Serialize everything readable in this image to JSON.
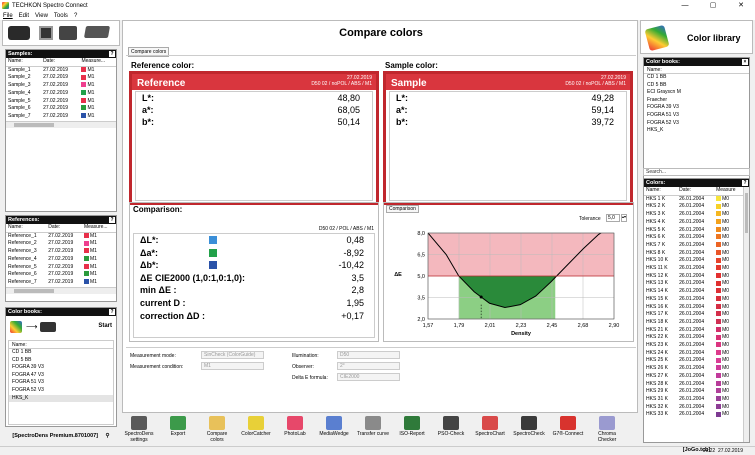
{
  "window": {
    "title": "TECHKON Spectro Connect",
    "min": "—",
    "max": "▢",
    "close": "✕"
  },
  "menu": [
    "File",
    "Edit",
    "View",
    "Tools",
    "?"
  ],
  "samples": {
    "header": "Samples:",
    "cols": [
      "Name:",
      "Date:",
      "Measure..."
    ],
    "rows": [
      {
        "name": "Sample_1",
        "date": "27.02.2019",
        "m": "M1",
        "color": "#e8304a"
      },
      {
        "name": "Sample_2",
        "date": "27.02.2019",
        "m": "M1",
        "color": "#e8304a"
      },
      {
        "name": "Sample_3",
        "date": "27.02.2019",
        "m": "M1",
        "color": "#ef3f8f"
      },
      {
        "name": "Sample_4",
        "date": "27.02.2019",
        "m": "M1",
        "color": "#22a14a"
      },
      {
        "name": "Sample_5",
        "date": "27.02.2019",
        "m": "M1",
        "color": "#e8304a"
      },
      {
        "name": "Sample_6",
        "date": "27.02.2019",
        "m": "M1",
        "color": "#2a9b3c"
      },
      {
        "name": "Sample_7",
        "date": "27.02.2019",
        "m": "M1",
        "color": "#2a52a8"
      }
    ]
  },
  "references": {
    "header": "References:",
    "cols": [
      "Name:",
      "Date:",
      "Measure..."
    ],
    "rows": [
      {
        "name": "Reference_1",
        "date": "27.02.2019",
        "m": "M1",
        "color": "#e8304a"
      },
      {
        "name": "Reference_2",
        "date": "27.02.2019",
        "m": "M1",
        "color": "#ef3f8f"
      },
      {
        "name": "Reference_3",
        "date": "27.02.2019",
        "m": "M1",
        "color": "#e8304a"
      },
      {
        "name": "Reference_4",
        "date": "27.02.2019",
        "m": "M1",
        "color": "#2a9b3c"
      },
      {
        "name": "Reference_5",
        "date": "27.02.2019",
        "m": "M1",
        "color": "#e8304a"
      },
      {
        "name": "Reference_6",
        "date": "27.02.2019",
        "m": "M1",
        "color": "#2a9b3c"
      },
      {
        "name": "Reference_7",
        "date": "27.02.2019",
        "m": "M1",
        "color": "#2a52a8"
      }
    ]
  },
  "colorbooks_left": {
    "header": "Color books:",
    "start": "Start",
    "name_col": "Name:",
    "items": [
      "CD 1 BB",
      "CD 5 BB",
      "FOGRA 39 V3",
      "FOGRA 47 V3",
      "FOGRA 51 V3",
      "FOGRA 52 V3",
      "HKS_K"
    ]
  },
  "status_left": "[SpectroDens Premium.8701007]",
  "main": {
    "title": "Compare colors",
    "tab": "Compare colors",
    "reference": {
      "section": "Reference color:",
      "name": "Reference",
      "date": "27.02.2019",
      "cond": "D50 02 / noPOL / ABS / M1",
      "L": "48,80",
      "a": "68,05",
      "b": "50,14",
      "color": "#d9363e"
    },
    "sample": {
      "section": "Sample color:",
      "name": "Sample",
      "date": "27.02.2019",
      "cond": "D50 02 / noPOL / ABS / M1",
      "L": "49,28",
      "a": "59,14",
      "b": "39,72",
      "color": "#d9363e"
    },
    "labels": {
      "L": "L*:",
      "a": "a*:",
      "b": "b*:"
    },
    "comparison": {
      "section": "Comparison:",
      "cond": "D50 02 / POL / ABS / M1",
      "rows": [
        {
          "label": "ΔL*:",
          "value": "0,48",
          "sw": "#3b8fd8"
        },
        {
          "label": "Δa*:",
          "value": "-8,92",
          "sw": "#22a14a"
        },
        {
          "label": "Δb*:",
          "value": "-10,42",
          "sw": "#2a52a8"
        },
        {
          "label": "ΔE CIE2000 (1,0:1,0:1,0):",
          "value": "3,5"
        },
        {
          "label": "min ΔE :",
          "value": "2,8"
        },
        {
          "label": "current D :",
          "value": "1,95"
        },
        {
          "label": "correction ΔD :",
          "value": "+0,17"
        }
      ]
    },
    "chart_tab": "Comparison",
    "tolerance_label": "Tolerance",
    "tolerance_value": "5,0",
    "settings": {
      "mode_label": "Measurement mode:",
      "mode_value": "SinCheck (ColorGuide)",
      "cond_label": "Measurement condition:",
      "cond_value": "M1",
      "illum_label": "Illumination:",
      "illum_value": "D50",
      "obs_label": "Observer:",
      "obs_value": "2°",
      "de_label": "Delta E formula:",
      "de_value": "CIE2000"
    }
  },
  "chart_data": {
    "type": "line",
    "xlabel": "Density",
    "ylabel": "ΔE",
    "xlim": [
      1.57,
      2.9
    ],
    "ylim": [
      2.0,
      8.0
    ],
    "xticks": [
      "1,57",
      "1,79",
      "2,01",
      "2,23",
      "2,45",
      "2,68",
      "2,90"
    ],
    "yticks": [
      "2,0",
      "3,5",
      "5,0",
      "6,5",
      "8,0"
    ],
    "tolerance": 5.0,
    "current_density": 1.95,
    "min_point": {
      "x": 2.12,
      "y": 2.8
    },
    "curve": [
      {
        "x": 1.57,
        "y": 8.0
      },
      {
        "x": 1.7,
        "y": 6.5
      },
      {
        "x": 1.79,
        "y": 5.0
      },
      {
        "x": 1.9,
        "y": 3.9
      },
      {
        "x": 2.01,
        "y": 3.1
      },
      {
        "x": 2.12,
        "y": 2.8
      },
      {
        "x": 2.23,
        "y": 3.0
      },
      {
        "x": 2.34,
        "y": 3.6
      },
      {
        "x": 2.45,
        "y": 4.6
      },
      {
        "x": 2.57,
        "y": 5.8
      },
      {
        "x": 2.68,
        "y": 6.9
      },
      {
        "x": 2.79,
        "y": 7.9
      },
      {
        "x": 2.9,
        "y": 8.6
      }
    ],
    "colors": {
      "above": "#f4b8be",
      "below": "#2a8a3a",
      "mid": "#8ccf84"
    }
  },
  "toolbar": [
    {
      "label": "SpectroDens settings",
      "color": "#5a5a5a"
    },
    {
      "label": "Export",
      "color": "#3c9a4a"
    },
    {
      "label": "Compare colors",
      "color": "#e8c15a"
    },
    {
      "label": "ColorCatcher",
      "color": "#e8d038"
    },
    {
      "label": "PhotoLab",
      "color": "#e7486a"
    },
    {
      "label": "MediaWedge",
      "color": "#5a7fd0"
    },
    {
      "label": "Transfer curve",
      "color": "#8a8a8a"
    },
    {
      "label": "ISO-Report",
      "color": "#2f7a3a"
    },
    {
      "label": "PSO-Check",
      "color": "#444444"
    },
    {
      "label": "SpectroChart",
      "color": "#d94a4a"
    },
    {
      "label": "SpectroCheck",
      "color": "#3a3a3a"
    },
    {
      "label": "G7®-Connect",
      "color": "#d8332e"
    },
    {
      "label": "Chroma Checker",
      "color": "#9a9ad0"
    }
  ],
  "right": {
    "title": "Color library",
    "books_header": "Color books:",
    "books_col": "Name:",
    "books": [
      "CD 1 BB",
      "CD 5 BB",
      "ECI Grayscn M",
      "Fraecher",
      "FOGRA 39 V3",
      "FOGRA 51 V3",
      "FOGRA 52 V3",
      "HKS_K"
    ],
    "search": "Search...",
    "colors_header": "Colors:",
    "colors_cols": [
      "Name:",
      "Date:",
      "Measure"
    ],
    "colors": [
      {
        "name": "HKS 1 K",
        "date": "26.01.2004",
        "m": "M0",
        "color": "#f6e43a"
      },
      {
        "name": "HKS 2 K",
        "date": "26.01.2004",
        "m": "M0",
        "color": "#f7d128"
      },
      {
        "name": "HKS 3 K",
        "date": "26.01.2004",
        "m": "M0",
        "color": "#f5b720"
      },
      {
        "name": "HKS 4 K",
        "date": "26.01.2004",
        "m": "M0",
        "color": "#f3a21c"
      },
      {
        "name": "HKS 5 K",
        "date": "26.01.2004",
        "m": "M0",
        "color": "#f08a1c"
      },
      {
        "name": "HKS 6 K",
        "date": "26.01.2004",
        "m": "M0",
        "color": "#ee7620"
      },
      {
        "name": "HKS 7 K",
        "date": "26.01.2004",
        "m": "M0",
        "color": "#ec6424"
      },
      {
        "name": "HKS 8 K",
        "date": "26.01.2004",
        "m": "M0",
        "color": "#ea5528"
      },
      {
        "name": "HKS 10 K",
        "date": "26.01.2004",
        "m": "M0",
        "color": "#e7432b"
      },
      {
        "name": "HKS 11 K",
        "date": "26.01.2004",
        "m": "M0",
        "color": "#e5392e"
      },
      {
        "name": "HKS 12 K",
        "date": "26.01.2004",
        "m": "M0",
        "color": "#e33030"
      },
      {
        "name": "HKS 13 K",
        "date": "26.01.2004",
        "m": "M0",
        "color": "#e0302f"
      },
      {
        "name": "HKS 14 K",
        "date": "26.01.2004",
        "m": "M0",
        "color": "#dd2f35"
      },
      {
        "name": "HKS 15 K",
        "date": "26.01.2004",
        "m": "M0",
        "color": "#d92e3b"
      },
      {
        "name": "HKS 16 K",
        "date": "26.01.2004",
        "m": "M0",
        "color": "#d62e44"
      },
      {
        "name": "HKS 17 K",
        "date": "26.01.2004",
        "m": "M0",
        "color": "#d42e4a"
      },
      {
        "name": "HKS 18 K",
        "date": "26.01.2004",
        "m": "M0",
        "color": "#d02f52"
      },
      {
        "name": "HKS 21 K",
        "date": "26.01.2004",
        "m": "M0",
        "color": "#d22f6a"
      },
      {
        "name": "HKS 22 K",
        "date": "26.01.2004",
        "m": "M0",
        "color": "#d83175"
      },
      {
        "name": "HKS 23 K",
        "date": "26.01.2004",
        "m": "M0",
        "color": "#db3580"
      },
      {
        "name": "HKS 24 K",
        "date": "26.01.2004",
        "m": "M0",
        "color": "#dd3a8c"
      },
      {
        "name": "HKS 25 K",
        "date": "26.01.2004",
        "m": "M0",
        "color": "#d93c95"
      },
      {
        "name": "HKS 26 K",
        "date": "26.01.2004",
        "m": "M0",
        "color": "#cf3a9a"
      },
      {
        "name": "HKS 27 K",
        "date": "26.01.2004",
        "m": "M0",
        "color": "#c23a9c"
      },
      {
        "name": "HKS 28 K",
        "date": "26.01.2004",
        "m": "M0",
        "color": "#b83c9a"
      },
      {
        "name": "HKS 29 K",
        "date": "26.01.2004",
        "m": "M0",
        "color": "#b0409a"
      },
      {
        "name": "HKS 31 K",
        "date": "26.01.2004",
        "m": "M0",
        "color": "#9a4098"
      },
      {
        "name": "HKS 32 K",
        "date": "26.01.2004",
        "m": "M0",
        "color": "#8e3e96"
      },
      {
        "name": "HKS 33 K",
        "date": "26.01.2004",
        "m": "M0",
        "color": "#7d3a92"
      }
    ],
    "status": "[JoGo.tcb]"
  },
  "statusbar": {
    "time": "09:22",
    "date": "27.02.2019"
  }
}
